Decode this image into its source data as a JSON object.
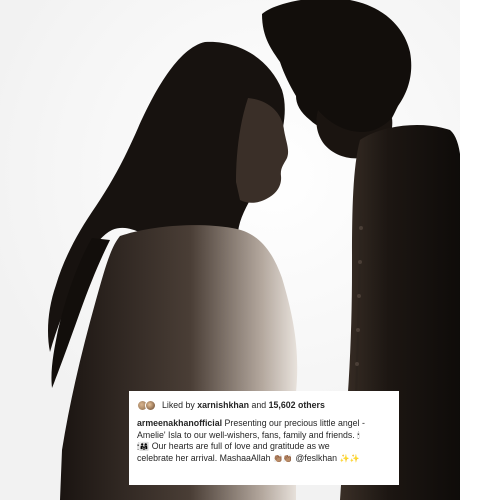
{
  "post": {
    "likes": {
      "prefix": "Liked by",
      "first_liker": "xarnishkhan",
      "connector": "and",
      "others": "15,602 others"
    },
    "caption": {
      "username": "armeenakhanofficial",
      "line1_text": "Presenting our precious little angel -",
      "line2": "Amelie' Isla to our well-wishers, fans, family and friends.",
      "line2_emoji": "🕯",
      "line3_emoji": "🕯👨‍👩‍👧",
      "line3_text": "Our hearts are full of love and gratitude as we",
      "line4_text": "celebrate her arrival. MashaaAllah",
      "line4_emoji": "👏🏽👏🏽",
      "mention": "@feslkhan",
      "sparkles": "✨✨"
    }
  },
  "colors": {
    "text": "#262626",
    "card": "#ffffff",
    "silhouette": "#14100d"
  }
}
